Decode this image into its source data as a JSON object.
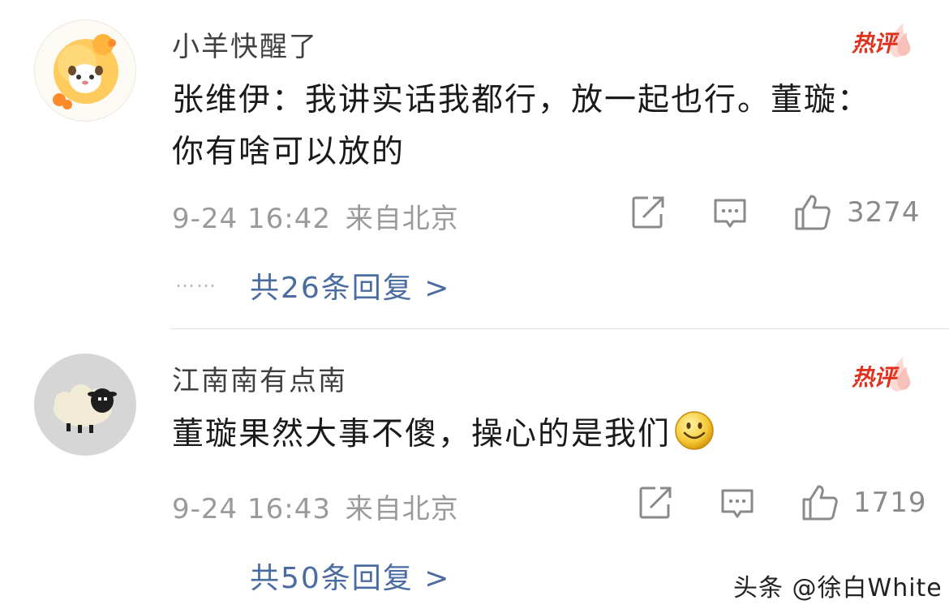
{
  "comments": [
    {
      "username": "小羊快醒了",
      "hot_label": "热评",
      "text": "张维伊：我讲实话我都行，放一起也行。董璇：你有啥可以放的",
      "time": "9-24 16:42",
      "location": "来自北京",
      "likes": "3274",
      "replies_label": "共26条回复 >",
      "dots": "……"
    },
    {
      "username": "江南南有点南",
      "hot_label": "热评",
      "text": "董璇果然大事不傻，操心的是我们",
      "emoji": "smiley-face",
      "time": "9-24 16:43",
      "location": "来自北京",
      "likes": "1719",
      "replies_label": "共50条回复 >"
    }
  ],
  "watermark": "头条 @徐白White",
  "colors": {
    "hot": "#e0331f",
    "link": "#4b6ca1",
    "meta": "#9a9a9a",
    "divider": "#e3e3e3"
  },
  "icons": [
    "share-icon",
    "comment-icon",
    "like-icon",
    "hot-flame-icon"
  ]
}
